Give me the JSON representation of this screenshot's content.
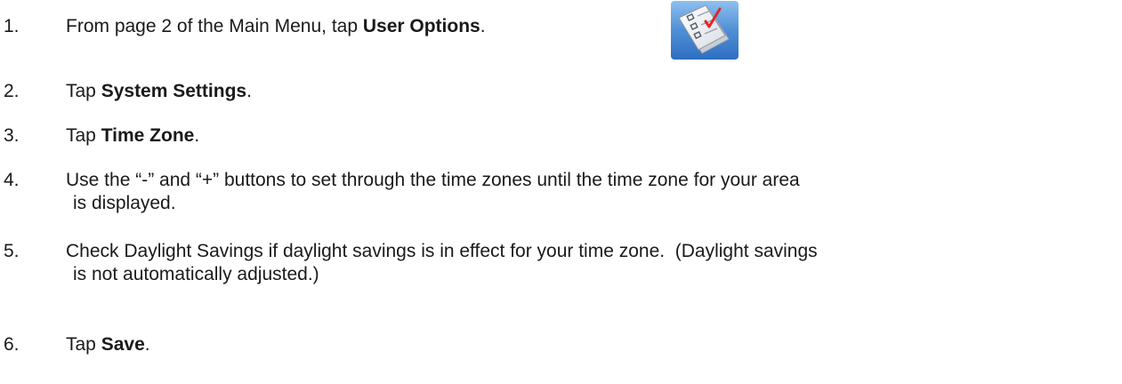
{
  "steps": [
    {
      "number": "1.",
      "before": "From page 2 of the Main Menu, tap ",
      "bold": "User Options",
      "after": "."
    },
    {
      "number": "2.",
      "before": "Tap ",
      "bold": "System Settings",
      "after": "."
    },
    {
      "number": "3.",
      "before": "Tap ",
      "bold": "Time Zone",
      "after": "."
    },
    {
      "number": "4.",
      "line1": "Use the “-” and “+” buttons to set through the time zones until the time zone for your area",
      "line2": "is displayed."
    },
    {
      "number": "5.",
      "line1": "Check Daylight Savings if daylight savings is in effect for your time zone.  (Daylight savings",
      "line2": "is not automatically adjusted.)"
    },
    {
      "number": "6.",
      "before": "Tap ",
      "bold": "Save",
      "after": "."
    }
  ],
  "icon": "user-options-checklist-icon",
  "colors": {
    "text": "#1a1a1a",
    "icon_bg": "#4f8fd6",
    "check": "#e0262b"
  }
}
